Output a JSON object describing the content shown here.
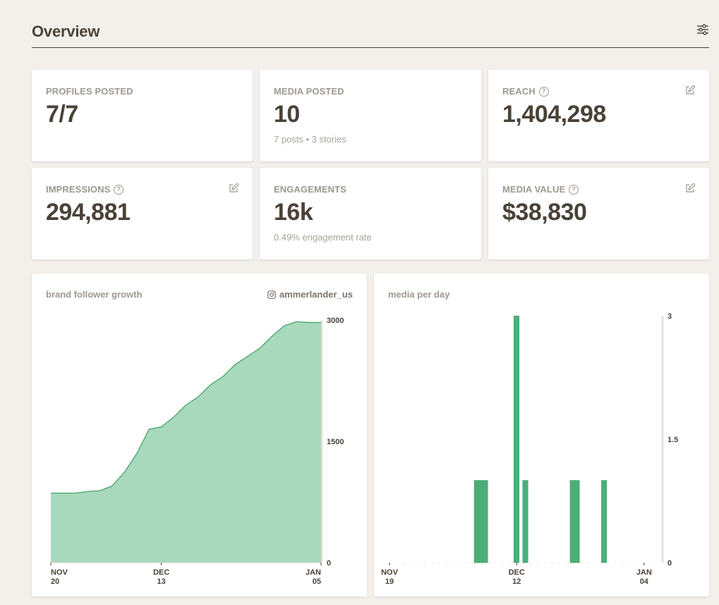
{
  "header": {
    "title": "Overview",
    "filter_icon": "sliders-icon"
  },
  "stats": {
    "profiles": {
      "label": "PROFILES POSTED",
      "value": "7/7"
    },
    "media": {
      "label": "MEDIA POSTED",
      "value": "10",
      "sub": "7 posts • 3 stories"
    },
    "reach": {
      "label": "REACH",
      "value": "1,404,298"
    },
    "impressions": {
      "label": "IMPRESSIONS",
      "value": "294,881"
    },
    "engagements": {
      "label": "ENGAGEMENTS",
      "value": "16k",
      "sub": "0.49% engagement rate"
    },
    "media_value": {
      "label": "MEDIA VALUE",
      "value": "$38,830"
    }
  },
  "follower_chart": {
    "title": "brand follower growth",
    "account": "ammerlander_us"
  },
  "media_chart": {
    "title": "media per day"
  },
  "colors": {
    "accent": "#4caf7a",
    "area_fill": "#a8d9bc",
    "area_line": "#5aaa78",
    "text": "#4a4238",
    "muted": "#9e9891",
    "background": "#f3f0ec"
  },
  "chart_data": [
    {
      "type": "area",
      "title": "brand follower growth",
      "x": [
        "Nov 20",
        "Nov 24",
        "Nov 28",
        "Dec 1",
        "Dec 3",
        "Dec 5",
        "Dec 7",
        "Dec 9",
        "Dec 11",
        "Dec 13",
        "Dec 15",
        "Dec 17",
        "Dec 19",
        "Dec 21",
        "Dec 23",
        "Dec 25",
        "Dec 27",
        "Dec 29",
        "Dec 31",
        "Jan 1",
        "Jan 2",
        "Jan 3",
        "Jan 5"
      ],
      "values": [
        860,
        860,
        860,
        880,
        890,
        950,
        1120,
        1350,
        1650,
        1680,
        1800,
        1950,
        2050,
        2200,
        2300,
        2450,
        2550,
        2650,
        2800,
        2930,
        2980,
        2970,
        2970
      ],
      "x_tick_labels": [
        [
          "NOV",
          "20"
        ],
        [
          "DEC",
          "13"
        ],
        [
          "JAN",
          "05"
        ]
      ],
      "y_tick_labels": [
        "3000",
        "1500",
        "0"
      ],
      "ylim": [
        0,
        3000
      ]
    },
    {
      "type": "bar",
      "title": "media per day",
      "x_tick_labels": [
        [
          "NOV",
          "19"
        ],
        [
          "DEC",
          "12"
        ],
        [
          "JAN",
          "04"
        ]
      ],
      "y_tick_labels": [
        "3",
        "1.5",
        "0"
      ],
      "ylim": [
        0,
        3
      ],
      "xlim": [
        0,
        46
      ],
      "bars": [
        {
          "day": 14.3,
          "value": 1
        },
        {
          "day": 15.0,
          "value": 1
        },
        {
          "day": 15.7,
          "value": 1
        },
        {
          "day": 21.0,
          "value": 3
        },
        {
          "day": 22.5,
          "value": 1
        },
        {
          "day": 30.5,
          "value": 1
        },
        {
          "day": 31.2,
          "value": 1
        },
        {
          "day": 35.8,
          "value": 1
        }
      ]
    }
  ]
}
